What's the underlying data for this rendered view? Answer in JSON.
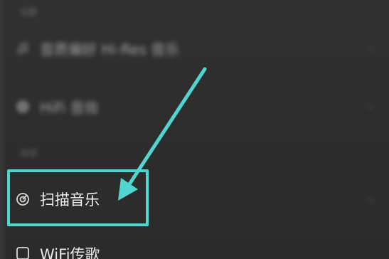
{
  "list": {
    "section_top": "设置",
    "items": [
      {
        "label": "音质偏好 Hi-Res 音乐",
        "icon": "music-note-icon"
      },
      {
        "label": "HiFi 音效",
        "icon": "hifi-icon"
      }
    ],
    "section_mid": "本地",
    "scan_item": {
      "label": "扫描音乐",
      "icon": "scan-target-icon"
    },
    "wifi_item": {
      "label": "WiFi传歌",
      "icon": "wifi-transfer-icon"
    }
  },
  "annotation": {
    "color": "#4fd6d0",
    "target": "scan_item"
  }
}
